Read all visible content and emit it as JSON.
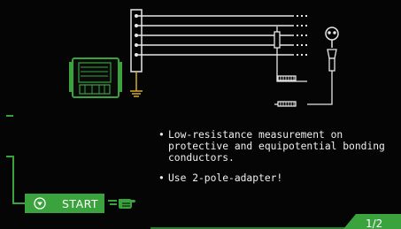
{
  "info": {
    "items": [
      "Low-resistance measurement on protective and equipotential bonding conductors.",
      "Use 2-pole-adapter!"
    ]
  },
  "start": {
    "label": "START",
    "icon": "chevron-down-circle-icon"
  },
  "hand": {
    "icon": "pointing-hand-icon"
  },
  "page": {
    "indicator": "1/2"
  },
  "colors": {
    "accent": "#3aa33e",
    "background": "#050505",
    "line": "#e6e6e6",
    "ground": "#d8a92a"
  }
}
